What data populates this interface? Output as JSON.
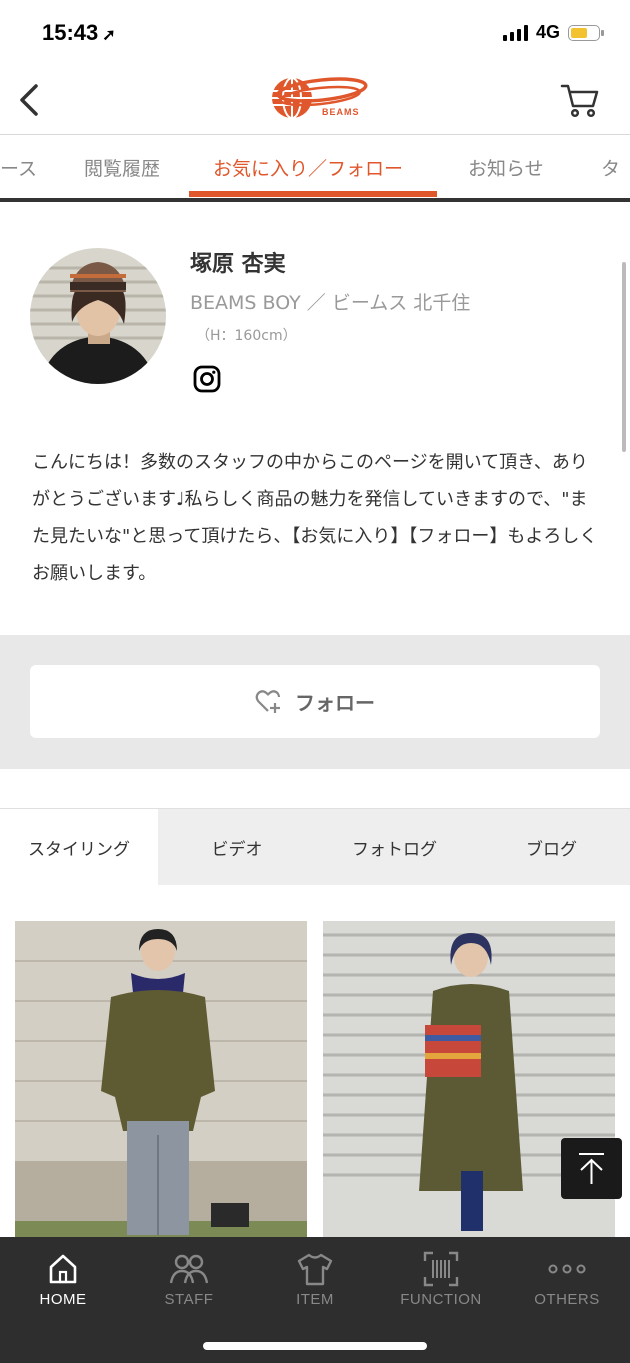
{
  "status": {
    "time": "15:43",
    "network": "4G"
  },
  "header": {
    "brand": "BEAMS"
  },
  "tabs": [
    {
      "label": "ース"
    },
    {
      "label": "閲覧履歴"
    },
    {
      "label": "お気に入り／フォロー",
      "active": true
    },
    {
      "label": "お知らせ"
    },
    {
      "label": "タ"
    }
  ],
  "profile": {
    "name": "塚原 杏実",
    "shop": "BEAMS BOY ／ ビームス 北千住",
    "height": "（H：160cm）",
    "intro": "こんにちは！多数のスタッフの中からこのページを開いて頂き、ありがとうございます♩私らしく商品の魅力を発信していきますので、\"また見たいな\"と思って頂けたら、【お気に入り】【フォロー】もよろしくお願いします。"
  },
  "follow": {
    "label": "フォロー"
  },
  "content_tabs": [
    {
      "label": "スタイリング",
      "active": true
    },
    {
      "label": "ビデオ"
    },
    {
      "label": "フォトログ"
    },
    {
      "label": "ブログ"
    }
  ],
  "bottom_nav": [
    {
      "label": "HOME",
      "icon": "home-icon",
      "active": true
    },
    {
      "label": "STAFF",
      "icon": "staff-icon"
    },
    {
      "label": "ITEM",
      "icon": "shirt-icon"
    },
    {
      "label": "FUNCTION",
      "icon": "barcode-icon"
    },
    {
      "label": "OTHERS",
      "icon": "more-icon"
    }
  ],
  "colors": {
    "accent": "#e0572c",
    "nav_bg": "#2e2e2e"
  }
}
